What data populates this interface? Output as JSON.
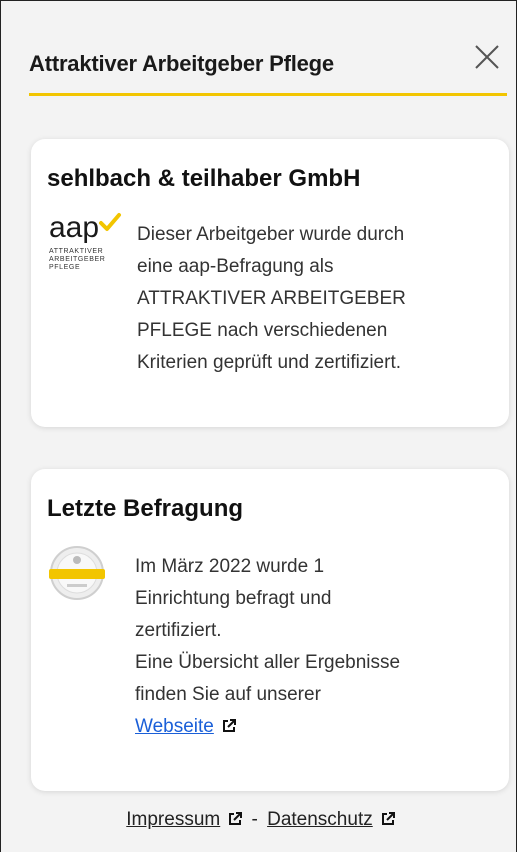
{
  "header": {
    "title": "Attraktiver Arbeitgeber Pflege",
    "close_icon": "close-icon",
    "accent_color": "#f2c500"
  },
  "company_card": {
    "name": "sehlbach & teilhaber GmbH",
    "logo_text_main": "aap",
    "logo_text_sub": [
      "ATTRAKTIVER",
      "ARBEITGEBER",
      "PFLEGE"
    ],
    "description_lines": [
      "Dieser Arbeitgeber wurde durch",
      "eine aap-Befragung als",
      "ATTRAKTIVER ARBEITGEBER",
      "PFLEGE nach verschiedenen",
      "Kriterien geprüft und zertifiziert."
    ]
  },
  "survey_card": {
    "title": "Letzte Befragung",
    "seal_icon": "certification-seal-icon",
    "text_lines": [
      "Im März 2022 wurde 1",
      "Einrichtung befragt und",
      "zertifiziert.",
      "Eine Übersicht aller Ergebnisse",
      "finden Sie auf unserer"
    ],
    "link_label": "Webseite"
  },
  "footer": {
    "impressum_label": "Impressum",
    "separator": "-",
    "datenschutz_label": "Datenschutz"
  }
}
